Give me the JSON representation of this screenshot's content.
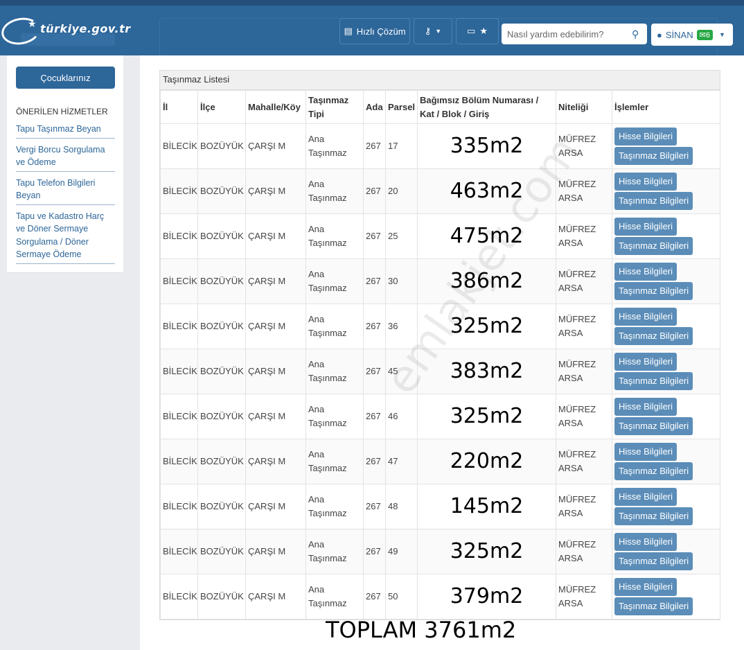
{
  "header": {
    "logo_text": "türkiye.gov.tr",
    "quick_solution_label": "Hızlı Çözüm",
    "search_placeholder": "Nasıl yardım edebilirim?",
    "user_name": "SİNAN",
    "message_count": "6",
    "icons": [
      "chat-icon",
      "key-icon",
      "id-card-icon",
      "star-icon",
      "search-icon",
      "user-icon",
      "mail-icon",
      "chevron-down-icon"
    ]
  },
  "sidebar": {
    "children_button": "Çocuklarınız",
    "section_title": "ÖNERİLEN HİZMETLER",
    "items": [
      {
        "label": "Tapu Taşınmaz Beyan"
      },
      {
        "label": "Vergi Borcu Sorgulama ve Ödeme"
      },
      {
        "label": "Tapu Telefon Bilgileri Beyan"
      },
      {
        "label": "Tapu ve Kadastro Harç ve Döner Sermaye Sorgulama / Döner Sermaye Ödeme"
      }
    ]
  },
  "panel": {
    "title": "Taşınmaz Listesi",
    "columns": [
      "İl",
      "İlçe",
      "Mahalle/Köy",
      "Taşınmaz Tipi",
      "Ada",
      "Parsel",
      "Bağımsız Bölüm Numarası / Kat / Blok / Giriş",
      "Niteliği",
      "İşlemler"
    ],
    "action_share": "Hisse Bilgileri",
    "action_property": "Taşınmaz Bilgileri",
    "rows": [
      {
        "il": "BİLECİK",
        "ilce": "BOZÜYÜK",
        "mahalle": "ÇARŞI M",
        "tip": "Ana Taşınmaz",
        "ada": "267",
        "parsel": "17",
        "area": "335m2",
        "nitelik": "MÜFREZ ARSA"
      },
      {
        "il": "BİLECİK",
        "ilce": "BOZÜYÜK",
        "mahalle": "ÇARŞI M",
        "tip": "Ana Taşınmaz",
        "ada": "267",
        "parsel": "20",
        "area": "463m2",
        "nitelik": "MÜFREZ ARSA"
      },
      {
        "il": "BİLECİK",
        "ilce": "BOZÜYÜK",
        "mahalle": "ÇARŞI M",
        "tip": "Ana Taşınmaz",
        "ada": "267",
        "parsel": "25",
        "area": "475m2",
        "nitelik": "MÜFREZ ARSA"
      },
      {
        "il": "BİLECİK",
        "ilce": "BOZÜYÜK",
        "mahalle": "ÇARŞI M",
        "tip": "Ana Taşınmaz",
        "ada": "267",
        "parsel": "30",
        "area": "386m2",
        "nitelik": "MÜFREZ ARSA"
      },
      {
        "il": "BİLECİK",
        "ilce": "BOZÜYÜK",
        "mahalle": "ÇARŞI M",
        "tip": "Ana Taşınmaz",
        "ada": "267",
        "parsel": "36",
        "area": "325m2",
        "nitelik": "MÜFREZ ARSA"
      },
      {
        "il": "BİLECİK",
        "ilce": "BOZÜYÜK",
        "mahalle": "ÇARŞI M",
        "tip": "Ana Taşınmaz",
        "ada": "267",
        "parsel": "45",
        "area": "383m2",
        "nitelik": "MÜFREZ ARSA"
      },
      {
        "il": "BİLECİK",
        "ilce": "BOZÜYÜK",
        "mahalle": "ÇARŞI M",
        "tip": "Ana Taşınmaz",
        "ada": "267",
        "parsel": "46",
        "area": "325m2",
        "nitelik": "MÜFREZ ARSA"
      },
      {
        "il": "BİLECİK",
        "ilce": "BOZÜYÜK",
        "mahalle": "ÇARŞI M",
        "tip": "Ana Taşınmaz",
        "ada": "267",
        "parsel": "47",
        "area": "220m2",
        "nitelik": "MÜFREZ ARSA"
      },
      {
        "il": "BİLECİK",
        "ilce": "BOZÜYÜK",
        "mahalle": "ÇARŞI M",
        "tip": "Ana Taşınmaz",
        "ada": "267",
        "parsel": "48",
        "area": "145m2",
        "nitelik": "MÜFREZ ARSA"
      },
      {
        "il": "BİLECİK",
        "ilce": "BOZÜYÜK",
        "mahalle": "ÇARŞI M",
        "tip": "Ana Taşınmaz",
        "ada": "267",
        "parsel": "49",
        "area": "325m2",
        "nitelik": "MÜFREZ ARSA"
      },
      {
        "il": "BİLECİK",
        "ilce": "BOZÜYÜK",
        "mahalle": "ÇARŞI M",
        "tip": "Ana Taşınmaz",
        "ada": "267",
        "parsel": "50",
        "area": "379m2",
        "nitelik": "MÜFREZ ARSA"
      }
    ]
  },
  "total_text": "TOPLAM  3761m2",
  "watermark": "emlakjet.com",
  "colors": {
    "brand": "#2d6699",
    "action": "#5b8db8",
    "badge": "#27a844"
  }
}
